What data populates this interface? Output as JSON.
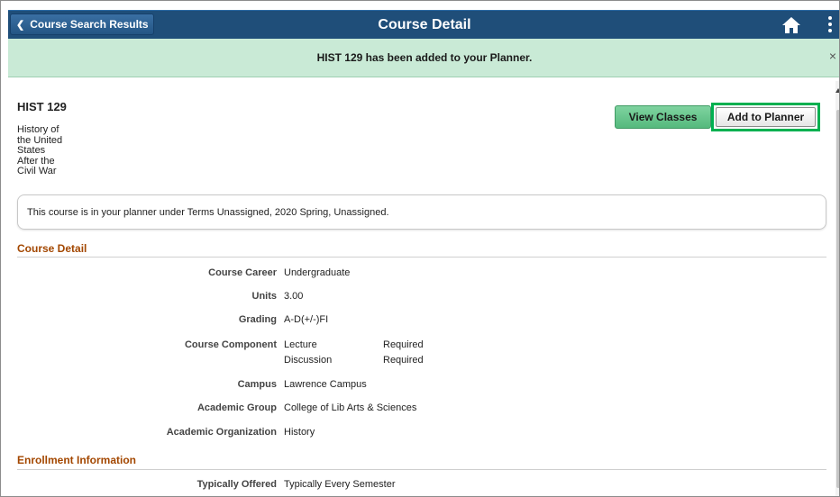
{
  "header": {
    "back_label": "Course Search Results",
    "title": "Course Detail"
  },
  "message": {
    "text": "HIST 129 has been added to your Planner.",
    "close": "×"
  },
  "course": {
    "code": "HIST 129",
    "title_lines": [
      "History of",
      "the United",
      "States",
      "After the",
      "Civil War"
    ]
  },
  "buttons": {
    "view_classes": "View Classes",
    "add_to_planner": "Add to Planner"
  },
  "notice": "This course is in your planner under Terms Unassigned, 2020 Spring, Unassigned.",
  "course_detail": {
    "heading": "Course Detail",
    "career_label": "Course Career",
    "career_value": "Undergraduate",
    "units_label": "Units",
    "units_value": "3.00",
    "grading_label": "Grading",
    "grading_value": "A-D(+/-)FI",
    "component_label": "Course Component",
    "components": [
      {
        "name": "Lecture",
        "status": "Required"
      },
      {
        "name": "Discussion",
        "status": "Required"
      }
    ],
    "campus_label": "Campus",
    "campus_value": "Lawrence Campus",
    "group_label": "Academic Group",
    "group_value": "College of Lib Arts & Sciences",
    "org_label": "Academic Organization",
    "org_value": "History"
  },
  "enrollment": {
    "heading": "Enrollment Information",
    "offered_label": "Typically Offered",
    "offered_value": "Typically Every Semester"
  },
  "colors": {
    "header_bg": "#1f4e79",
    "message_bg": "#c9ead6",
    "section_heading": "#a34700",
    "highlight_border": "#00b050"
  }
}
